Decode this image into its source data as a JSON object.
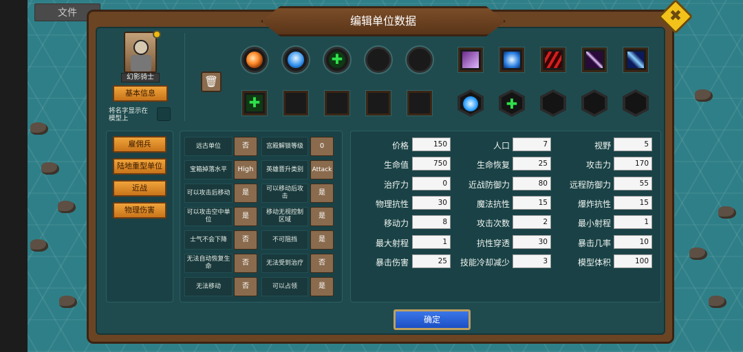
{
  "menu": {
    "file_tab": "文件"
  },
  "dialog": {
    "title": "编辑单位数据",
    "close_icon": "close-x-icon"
  },
  "unit": {
    "name": "幻影骑士",
    "basic_info_label": "基本信息",
    "show_name_label": "将名字显示在模型上"
  },
  "skills": {
    "top_round": [
      "fire-orb-skill-icon",
      "human-figure-skill-icon",
      "heal-cross-skill-icon",
      "empty-slot",
      "empty-slot"
    ],
    "top_square": [
      "ghost-skill-icon",
      "frost-spirit-skill-icon",
      "claw-slash-skill-icon",
      "blade-strike-skill-icon",
      "wind-slash-skill-icon"
    ],
    "bottom_square": [
      "heal-cross-skill-icon",
      "empty-slot",
      "empty-slot",
      "empty-slot",
      "empty-slot"
    ],
    "bottom_hex": [
      "spider-skill-icon",
      "heal-cross-skill-icon",
      "empty-slot",
      "empty-slot",
      "empty-slot"
    ]
  },
  "tags": [
    "雇佣兵",
    "陆地重型单位",
    "近战",
    "物理伤害"
  ],
  "flags": [
    {
      "label": "远古单位",
      "value": "否"
    },
    {
      "label": "宫殿解锁等级",
      "value": "0"
    },
    {
      "label": "宝箱掉落水平",
      "value": "High"
    },
    {
      "label": "英雄晋升类别",
      "value": "Attack"
    },
    {
      "label": "可以攻击后移动",
      "value": "是"
    },
    {
      "label": "可以移动后攻击",
      "value": "是"
    },
    {
      "label": "可以攻击空中单位",
      "value": "是"
    },
    {
      "label": "移动无视控制区域",
      "value": "是"
    },
    {
      "label": "士气不会下降",
      "value": "否"
    },
    {
      "label": "不可阻挡",
      "value": "是"
    },
    {
      "label": "无法自动恢复生命",
      "value": "否"
    },
    {
      "label": "无法受到治疗",
      "value": "否"
    },
    {
      "label": "无法移动",
      "value": "否"
    },
    {
      "label": "可以占领",
      "value": "是"
    }
  ],
  "stats": [
    {
      "label": "价格",
      "value": "150"
    },
    {
      "label": "人口",
      "value": "7"
    },
    {
      "label": "视野",
      "value": "5"
    },
    {
      "label": "生命值",
      "value": "750"
    },
    {
      "label": "生命恢复",
      "value": "25"
    },
    {
      "label": "攻击力",
      "value": "170"
    },
    {
      "label": "治疗力",
      "value": "0"
    },
    {
      "label": "近战防御力",
      "value": "80"
    },
    {
      "label": "远程防御力",
      "value": "55"
    },
    {
      "label": "物理抗性",
      "value": "30"
    },
    {
      "label": "魔法抗性",
      "value": "15"
    },
    {
      "label": "爆炸抗性",
      "value": "15"
    },
    {
      "label": "移动力",
      "value": "8"
    },
    {
      "label": "攻击次数",
      "value": "2"
    },
    {
      "label": "最小射程",
      "value": "1"
    },
    {
      "label": "最大射程",
      "value": "1"
    },
    {
      "label": "抗性穿透",
      "value": "30"
    },
    {
      "label": "暴击几率",
      "value": "10"
    },
    {
      "label": "暴击伤害",
      "value": "25"
    },
    {
      "label": "技能冷却减少",
      "value": "3"
    },
    {
      "label": "模型体积",
      "value": "100"
    }
  ],
  "confirm_label": "确定"
}
